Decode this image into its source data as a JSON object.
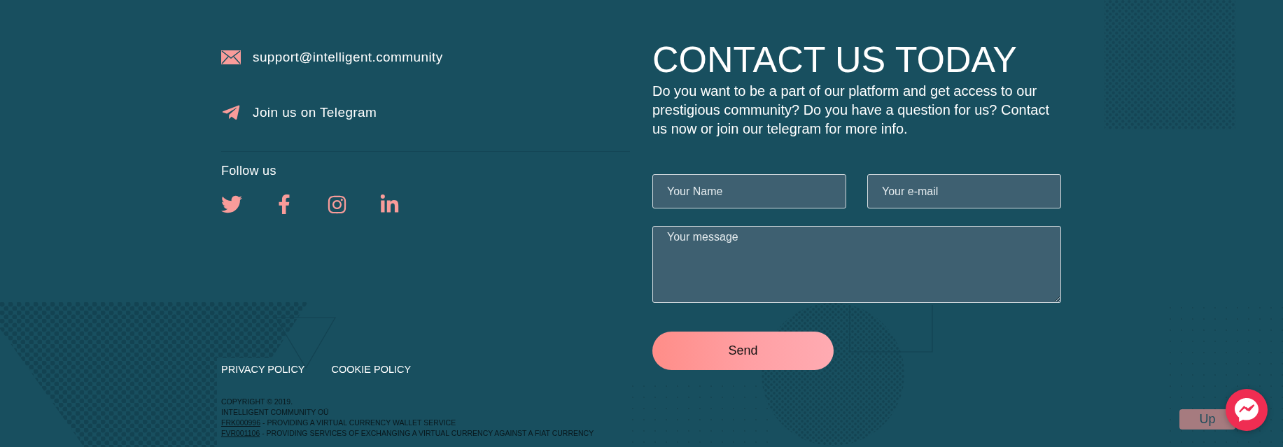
{
  "contacts": [
    {
      "kind": "email",
      "text": "support@intelligent.community"
    },
    {
      "kind": "telegram",
      "text": "Join us on Telegram"
    }
  ],
  "follow": {
    "title": "Follow us",
    "networks": [
      {
        "kind": "twitter"
      },
      {
        "kind": "facebook"
      },
      {
        "kind": "instagram"
      },
      {
        "kind": "linkedin"
      }
    ]
  },
  "policies": [
    "PRIVACY POLICY",
    "COOKIE POLICY"
  ],
  "legal": {
    "lines": [
      "COPYRIGHT © 2019.",
      "INTELLIGENT COMMUNITY OÜ"
    ],
    "licenses": [
      {
        "code": "FRK000996",
        "text": "- PROVIDING A VIRTUAL CURRENCY WALLET SERVICE"
      },
      {
        "code": "FVR001106",
        "text": "- PROVIDING SERVICES OF EXCHANGING A VIRTUAL CURRENCY AGAINST A FIAT CURRENCY"
      }
    ]
  },
  "contact_form": {
    "title": "CONTACT US TODAY",
    "intro": "Do you want to be a part of our platform and get access to our prestigious community? Do you have a question for us? Contact us now or join our telegram for more info.",
    "fields": [
      {
        "kind": "input",
        "placeholder": "Your Name"
      },
      {
        "kind": "input",
        "placeholder": "Your e-mail"
      },
      {
        "kind": "textarea",
        "placeholder": "Your message"
      }
    ],
    "submit": "Send"
  },
  "up_button": "Up"
}
